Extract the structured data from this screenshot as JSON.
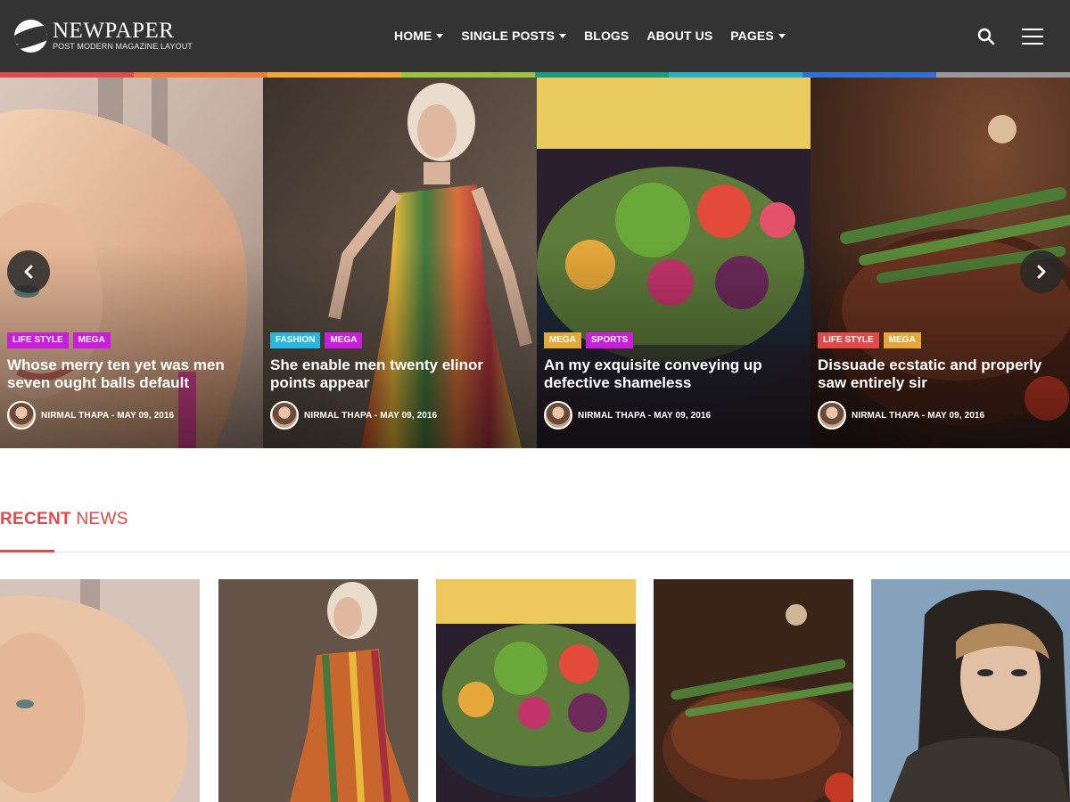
{
  "site": {
    "name": "NEWPAPER",
    "tagline": "POST MODERN MAGAZINE LAYOUT"
  },
  "nav": {
    "items": [
      {
        "label": "HOME",
        "has_dropdown": true
      },
      {
        "label": "SINGLE POSTS",
        "has_dropdown": true
      },
      {
        "label": "BLOGS",
        "has_dropdown": false
      },
      {
        "label": "ABOUT US",
        "has_dropdown": false
      },
      {
        "label": "PAGES",
        "has_dropdown": true
      }
    ],
    "search_icon": "search-icon",
    "menu_icon": "hamburger-menu-icon"
  },
  "color_bar": [
    "#e04a4a",
    "#f07b3f",
    "#f6a832",
    "#9bc53d",
    "#1b9c85",
    "#2bb0c9",
    "#2d6fdb",
    "#999999"
  ],
  "slider": {
    "prev_icon": "chevron-left-icon",
    "next_icon": "chevron-right-icon",
    "slides": [
      {
        "tags": [
          {
            "label": "LIFE STYLE",
            "color": "#c81ddb"
          },
          {
            "label": "MEGA",
            "color": "#c81ddb"
          }
        ],
        "title": "Whose merry ten yet was men seven ought balls default",
        "meta": "NIRMAL THAPA - MAY 09, 2016"
      },
      {
        "tags": [
          {
            "label": "FASHION",
            "color": "#27b7dd"
          },
          {
            "label": "MEGA",
            "color": "#c81ddb"
          }
        ],
        "title": "She enable men twenty elinor points appear",
        "meta": "NIRMAL THAPA - MAY 09, 2016"
      },
      {
        "tags": [
          {
            "label": "MEGA",
            "color": "#e2a83a"
          },
          {
            "label": "SPORTS",
            "color": "#c81ddb"
          }
        ],
        "title": "An my exquisite conveying up defective shameless",
        "meta": "NIRMAL THAPA - MAY 09, 2016"
      },
      {
        "tags": [
          {
            "label": "LIFE STYLE",
            "color": "#e04a4a"
          },
          {
            "label": "MEGA",
            "color": "#e2a83a"
          }
        ],
        "title": "Dissuade ecstatic and properly saw entirely sir",
        "meta": "NIRMAL THAPA - MAY 09, 2016"
      }
    ]
  },
  "recent": {
    "title_bold": "RECENT",
    "title_light": "NEWS"
  }
}
